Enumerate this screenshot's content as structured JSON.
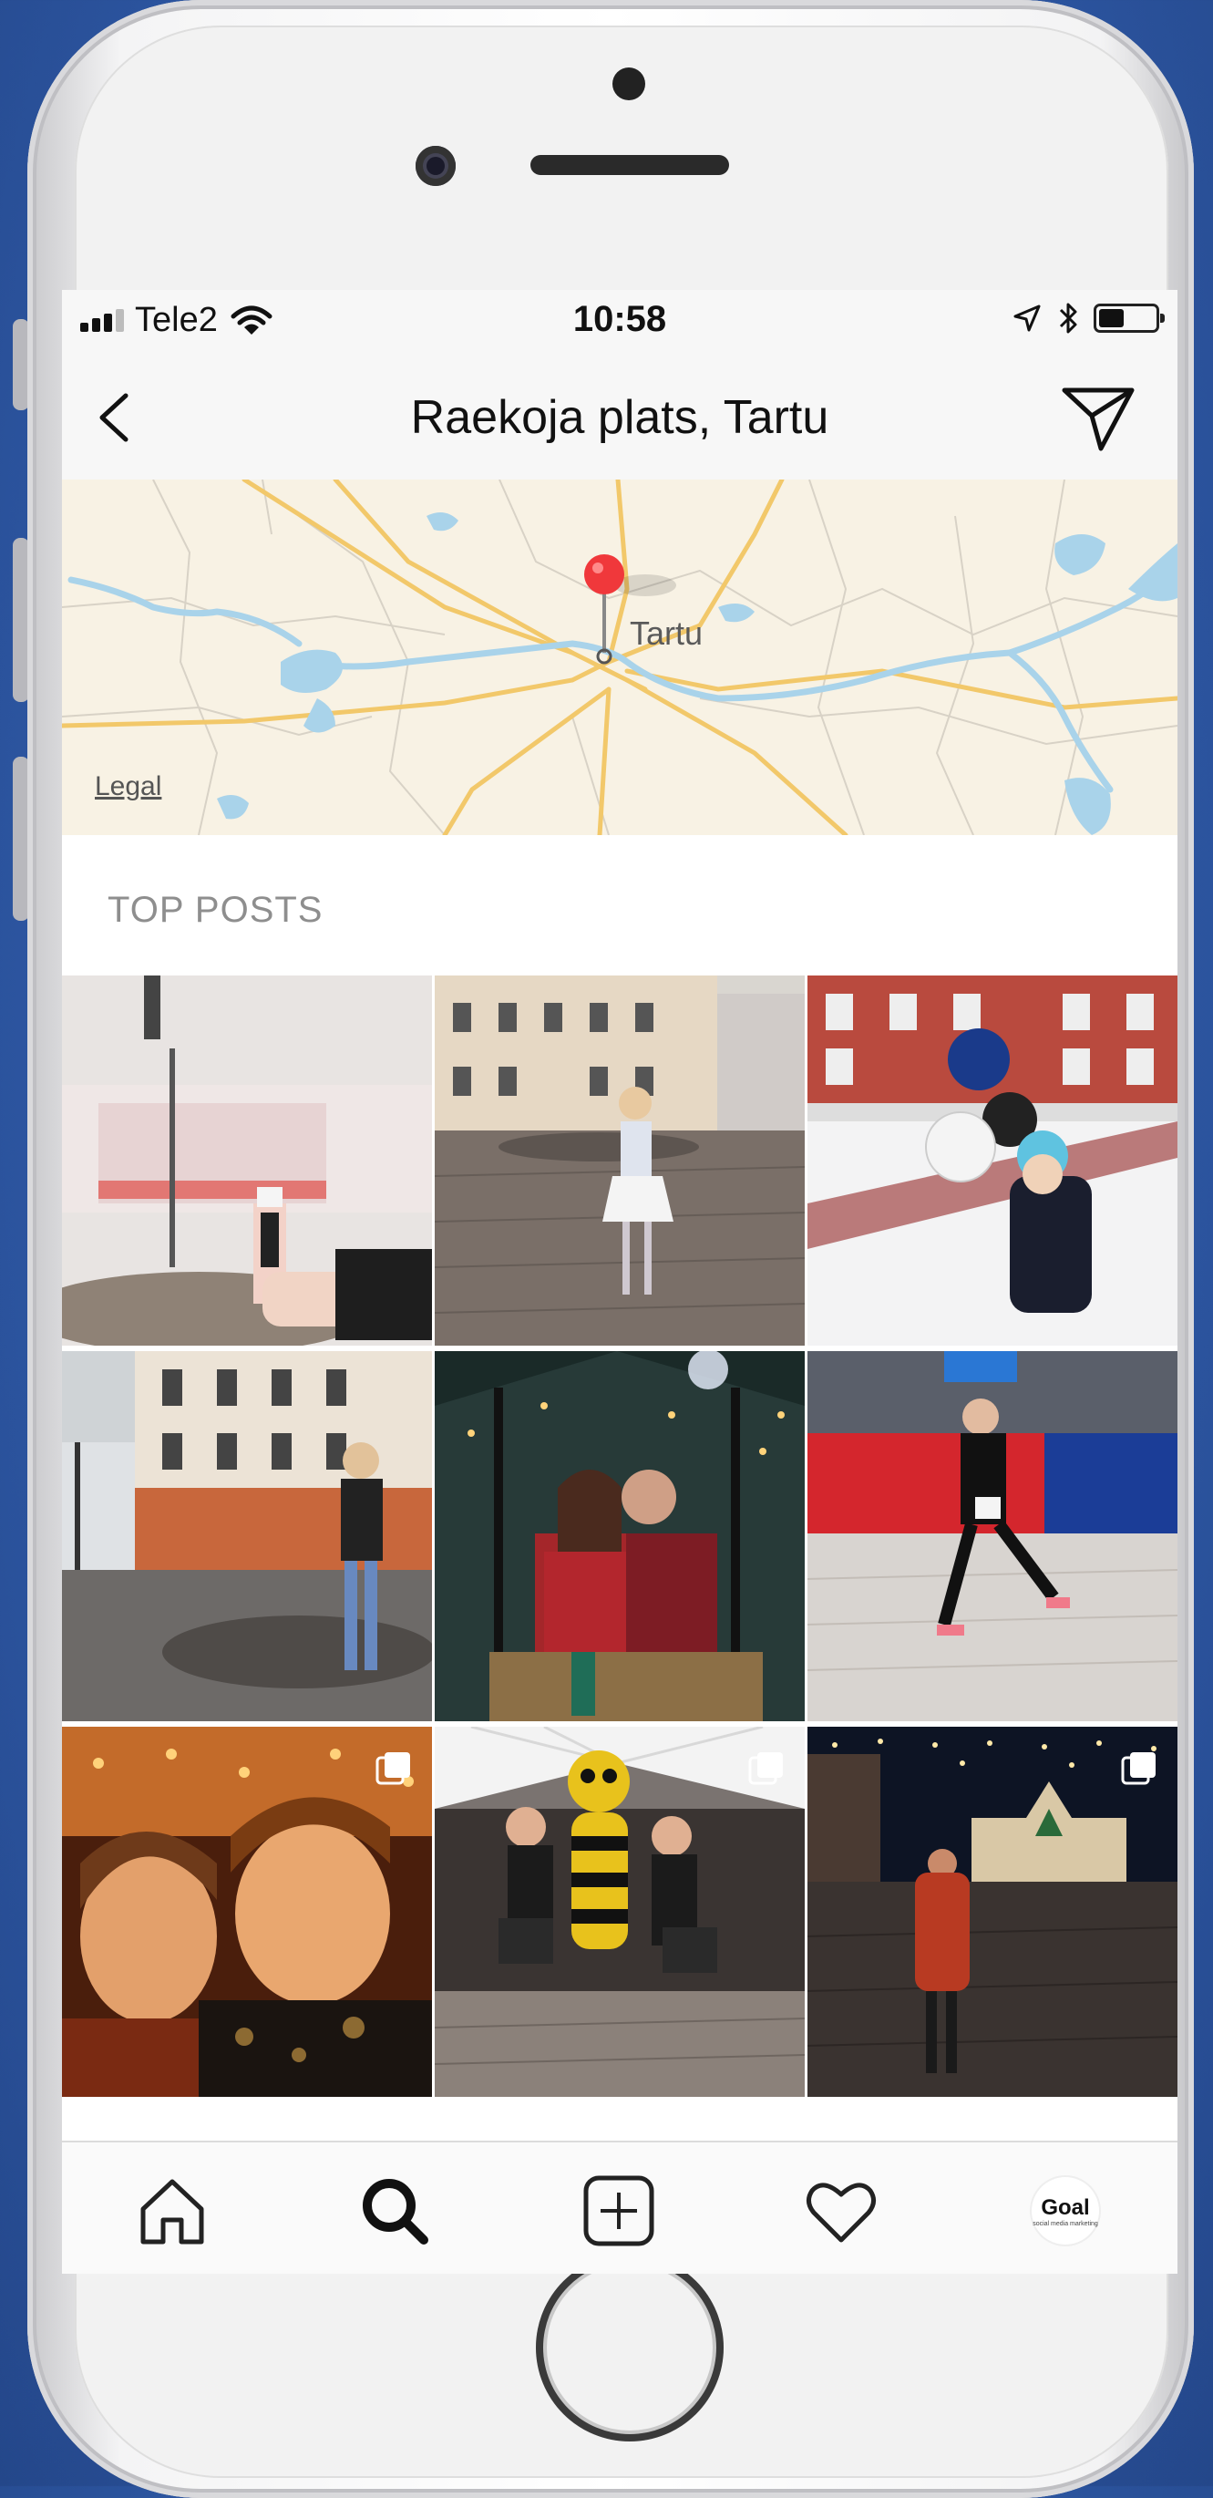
{
  "status_bar": {
    "carrier": "Tele2",
    "time": "10:58",
    "battery_level": 0.45
  },
  "header": {
    "title": "Raekoja plats, Tartu",
    "back_icon": "chevron-left-icon",
    "send_icon": "paper-plane-icon"
  },
  "map": {
    "city_label": "Tartu",
    "legal_link": "Legal",
    "pin_icon": "map-pin-icon"
  },
  "section": {
    "title": "TOP POSTS"
  },
  "posts": [
    {
      "desc": "coffee cup on table, town hall",
      "multi": false
    },
    {
      "desc": "woman posing on town square",
      "multi": false
    },
    {
      "desc": "child with balloons in snow",
      "multi": false
    },
    {
      "desc": "girl standing by fountain",
      "multi": false
    },
    {
      "desc": "couple kissing under lights",
      "multi": false
    },
    {
      "desc": "runner in race",
      "multi": false
    },
    {
      "desc": "selfie at night",
      "multi": true
    },
    {
      "desc": "bee mascot with two women",
      "multi": true
    },
    {
      "desc": "woman in red coat at night square",
      "multi": true
    }
  ],
  "tabbar": {
    "items": [
      "home-icon",
      "search-icon",
      "add-post-icon",
      "heart-icon",
      "profile-avatar"
    ],
    "profile_label": "Goal",
    "profile_sub": "social media marketing"
  },
  "colors": {
    "background": "#2f5aa8",
    "pin": "#f0383b",
    "water": "#a9d3ea",
    "map_land": "#f8f2e4"
  }
}
